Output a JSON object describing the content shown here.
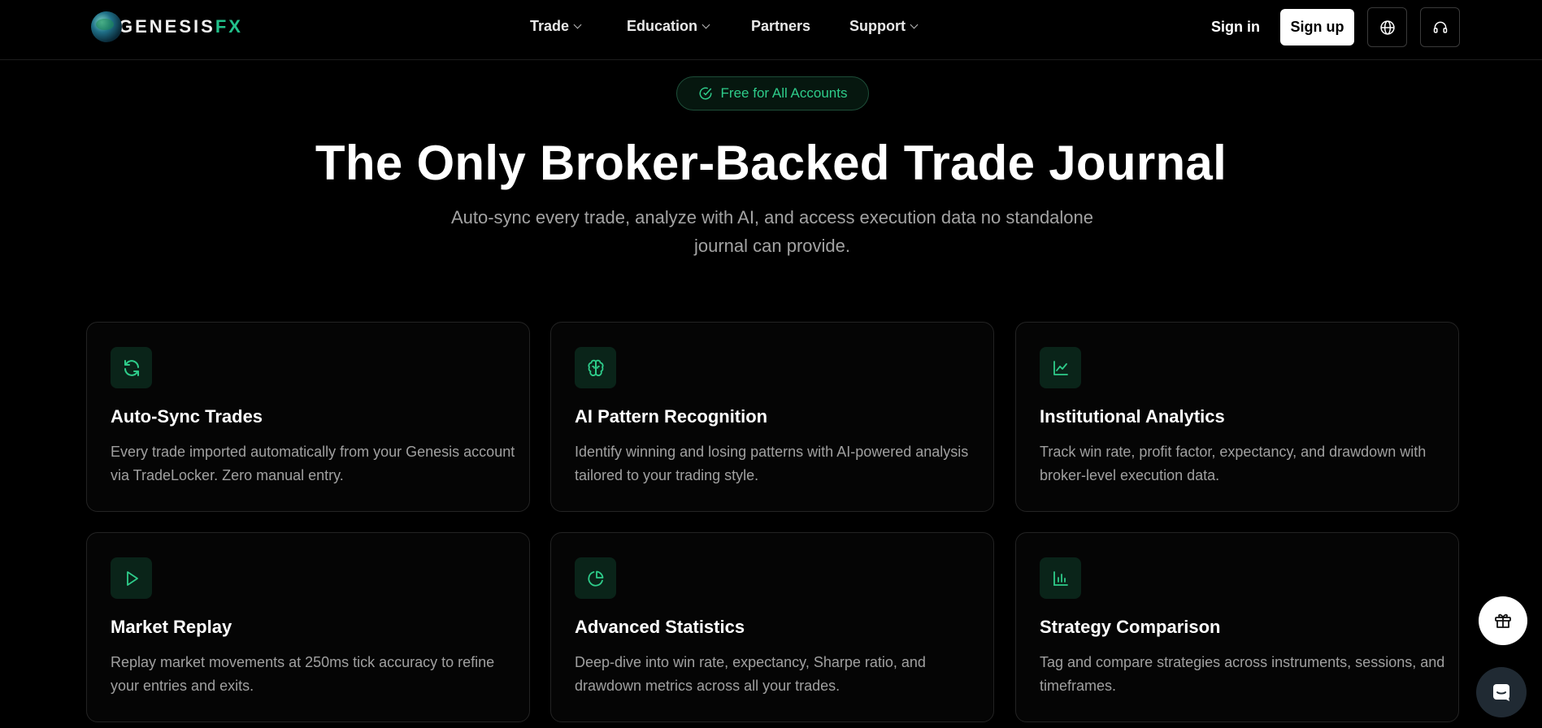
{
  "brand": {
    "name_main": "GENESIS",
    "name_accent": "FX"
  },
  "nav": {
    "items": [
      {
        "label": "Trade",
        "has_dropdown": true
      },
      {
        "label": "Education",
        "has_dropdown": true
      },
      {
        "label": "Partners",
        "has_dropdown": false
      },
      {
        "label": "Support",
        "has_dropdown": true
      }
    ],
    "sign_in": "Sign in",
    "sign_up": "Sign up",
    "icons": [
      "globe-icon",
      "headset-icon"
    ]
  },
  "hero": {
    "badge": "Free for All Accounts",
    "title": "The Only Broker-Backed Trade Journal",
    "subtitle": "Auto-sync every trade, analyze with AI, and access execution data no standalone journal can provide."
  },
  "features": [
    {
      "icon": "refresh-icon",
      "title": "Auto-Sync Trades",
      "description": "Every trade imported automatically from your Genesis account via TradeLocker. Zero manual entry."
    },
    {
      "icon": "brain-icon",
      "title": "AI Pattern Recognition",
      "description": "Identify winning and losing patterns with AI-powered analysis tailored to your trading style."
    },
    {
      "icon": "line-chart-icon",
      "title": "Institutional Analytics",
      "description": "Track win rate, profit factor, expectancy, and drawdown with broker-level execution data."
    },
    {
      "icon": "play-icon",
      "title": "Market Replay",
      "description": "Replay market movements at 250ms tick accuracy to refine your entries and exits."
    },
    {
      "icon": "pie-chart-icon",
      "title": "Advanced Statistics",
      "description": "Deep-dive into win rate, expectancy, Sharpe ratio, and drawdown metrics across all your trades."
    },
    {
      "icon": "bar-chart-icon",
      "title": "Strategy Comparison",
      "description": "Tag and compare strategies across instruments, sessions, and timeframes."
    }
  ],
  "floating": {
    "icons": [
      "gift-icon",
      "chat-icon"
    ]
  },
  "colors": {
    "accent": "#2ecc8a",
    "background": "#000000",
    "card_border": "#232323",
    "icon_bg": "#0a2419"
  }
}
